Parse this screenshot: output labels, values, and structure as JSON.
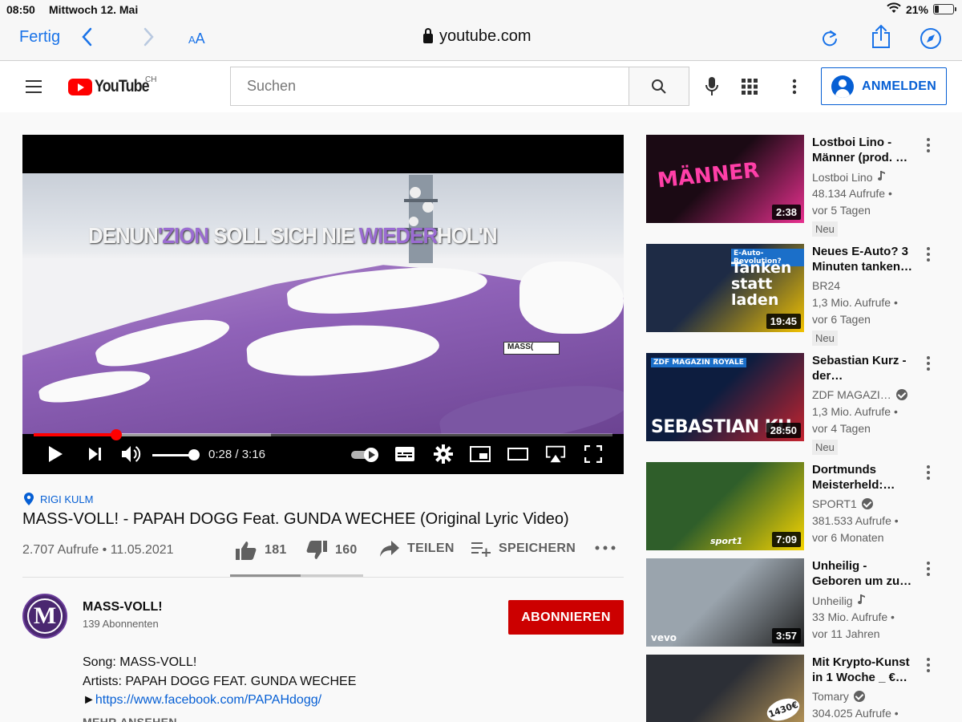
{
  "status": {
    "time": "08:50",
    "date": "Mittwoch 12. Mai",
    "battery": "21%"
  },
  "safari": {
    "done": "Fertig",
    "aa_small": "A",
    "aa_large": "A",
    "url": "youtube.com"
  },
  "youtube": {
    "logo_text": "YouTube",
    "country": "CH",
    "search_placeholder": "Suchen",
    "signin_label": "ANMELDEN"
  },
  "player": {
    "lyric_white_1": "DENUN",
    "lyric_violet_1": "'ZION",
    "lyric_white_2": " SOLL SICH NIE ",
    "lyric_violet_2": "WIEDER",
    "lyric_white_3": "HOL'N",
    "banner_text": "MASS(",
    "current_time": "0:28",
    "separator": "/",
    "duration": "3:16",
    "progress_fraction": 0.143,
    "buffer_fraction": 0.41,
    "volume_fraction": 1.0
  },
  "video": {
    "location": "RIGI KULM",
    "title": "MASS-VOLL! - PAPAH DOGG Feat. GUNDA WECHEE (Original Lyric Video)",
    "views": "2.707 Aufrufe",
    "date": "11.05.2021",
    "likes": "181",
    "dislikes": "160",
    "like_fraction": 0.53,
    "share_label": "TEILEN",
    "save_label": "SPEICHERN"
  },
  "channel": {
    "avatar_letter": "M",
    "name": "MASS-VOLL!",
    "subscribers": "139 Abonnenten",
    "subscribe_label": "ABONNIEREN"
  },
  "description": {
    "line1": "Song: MASS-VOLL!",
    "line2": "Artists: PAPAH DOGG FEAT. GUNDA WECHEE",
    "arrow": "►",
    "link": "https://www.facebook.com/PAPAHdogg/",
    "more_label": "MEHR ANSEHEN"
  },
  "recommendations": [
    {
      "title": "Lostboi Lino - Männer (prod. …",
      "channel": "Lostboi Lino",
      "badge": "music",
      "views": "48.134 Aufrufe •",
      "age": "vor 5 Tagen",
      "new": "Neu",
      "duration": "2:38",
      "thumb_text": "MÄNNER",
      "colors": [
        "#1b0a14",
        "#e8308f"
      ]
    },
    {
      "title": "Neues E-Auto? 3 Minuten tanken…",
      "channel": "BR24",
      "badge": "",
      "views": "1,3 Mio. Aufrufe •",
      "age": "vor 6 Tagen",
      "new": "Neu",
      "duration": "19:45",
      "thumb_text": "Tanken statt laden",
      "thumb_kicker": "E-Auto-Revolution?",
      "colors": [
        "#1e2b45",
        "#f2c200"
      ]
    },
    {
      "title": "Sebastian Kurz - der…",
      "channel": "ZDF MAGAZI…",
      "badge": "verified",
      "views": "1,3 Mio. Aufrufe •",
      "age": "vor 4 Tagen",
      "new": "Neu",
      "duration": "28:50",
      "thumb_text": "SEBASTIAN KU",
      "thumb_kicker": "ZDF MAGAZIN ROYALE",
      "colors": [
        "#0d1d3f",
        "#c4232f"
      ]
    },
    {
      "title": "Dortmunds Meisterheld:…",
      "channel": "SPORT1",
      "badge": "verified",
      "views": "381.533 Aufrufe •",
      "age": "vor 6 Monaten",
      "new": "",
      "duration": "7:09",
      "thumb_text": "sport1",
      "colors": [
        "#2f5e2a",
        "#f6d400"
      ]
    },
    {
      "title": "Unheilig - Geboren um zu…",
      "channel": "Unheilig",
      "badge": "music",
      "views": "33 Mio. Aufrufe •",
      "age": "vor 11 Jahren",
      "new": "",
      "duration": "3:57",
      "thumb_text": "vevo",
      "colors": [
        "#9aa4ad",
        "#1f1f1f"
      ]
    },
    {
      "title": "Mit Krypto-Kunst in 1 Woche _ €…",
      "channel": "Tomary",
      "badge": "verified",
      "views": "304.025 Aufrufe •",
      "age": "",
      "new": "",
      "duration": "",
      "thumb_text": "1430€",
      "colors": [
        "#2c2f36",
        "#c8a15a"
      ]
    }
  ]
}
